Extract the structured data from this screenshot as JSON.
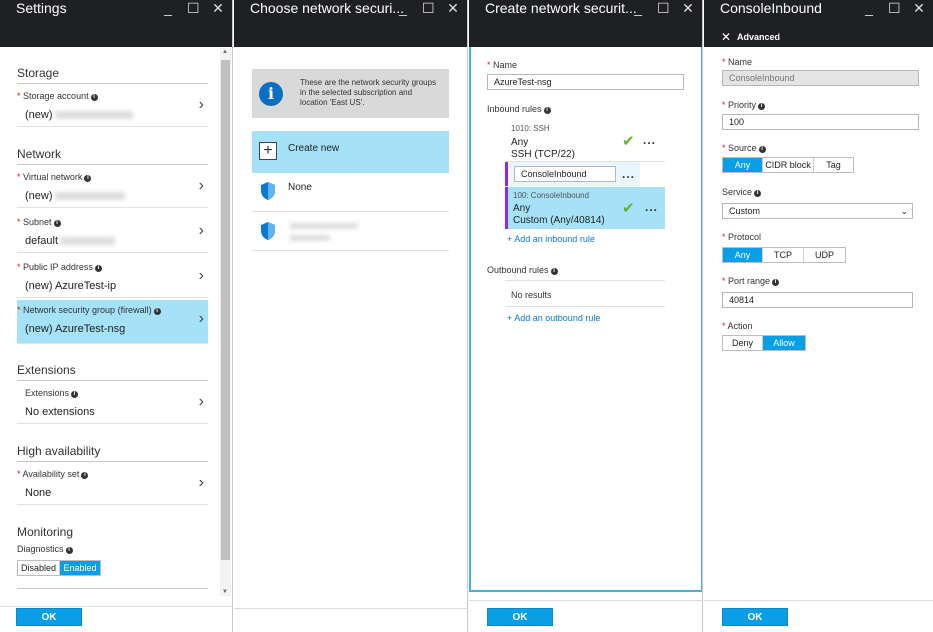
{
  "window_controls": {
    "minimize": "_",
    "maximize": "☐",
    "close": "✕"
  },
  "settings": {
    "title": "Settings",
    "storage": {
      "heading": "Storage",
      "account_label": "Storage account",
      "account_value": "(new)"
    },
    "network": {
      "heading": "Network",
      "vnet_label": "Virtual network",
      "vnet_value": "(new)",
      "subnet_label": "Subnet",
      "subnet_value": "default",
      "pip_label": "Public IP address",
      "pip_value": "(new) AzureTest-ip",
      "nsg_label": "Network security group (firewall)",
      "nsg_value": "(new) AzureTest-nsg"
    },
    "extensions": {
      "heading": "Extensions",
      "label": "Extensions",
      "value": "No extensions"
    },
    "ha": {
      "heading": "High availability",
      "label": "Availability set",
      "value": "None"
    },
    "monitoring": {
      "heading": "Monitoring",
      "label": "Diagnostics",
      "options": [
        "Disabled",
        "Enabled"
      ],
      "selected": "Enabled"
    },
    "ok": "OK"
  },
  "choose": {
    "title": "Choose network securi...",
    "info_text": "These are the network security groups in the selected subscription and location 'East US'.",
    "create_new": "Create new",
    "none": "None",
    "icons": {
      "info": "info-icon",
      "plus": "plus-icon",
      "shield": "shield-icon"
    }
  },
  "create": {
    "title": "Create network securit...",
    "name_label": "Name",
    "name_value": "AzureTest-nsg",
    "inbound_label": "Inbound rules",
    "rule1": {
      "header": "1010: SSH",
      "source": "Any",
      "service": "SSH (TCP/22)"
    },
    "edit_value": "ConsoleInbound",
    "rule2": {
      "header": "100: ConsoleInbound",
      "source": "Any",
      "service": "Custom (Any/40814)"
    },
    "add_inbound": "+ Add an inbound rule",
    "outbound_label": "Outbound rules",
    "no_results": "No results",
    "add_outbound": "+ Add an outbound rule",
    "more": "...",
    "ok": "OK"
  },
  "rule": {
    "title": "ConsoleInbound",
    "advanced": "Advanced",
    "name_label": "Name",
    "name_value": "ConsoleInbound",
    "priority_label": "Priority",
    "priority_value": "100",
    "source_label": "Source",
    "source_options": [
      "Any",
      "CIDR block",
      "Tag"
    ],
    "source_selected": "Any",
    "service_label": "Service",
    "service_value": "Custom",
    "protocol_label": "Protocol",
    "protocol_options": [
      "Any",
      "TCP",
      "UDP"
    ],
    "protocol_selected": "Any",
    "port_label": "Port range",
    "port_value": "40814",
    "action_label": "Action",
    "action_options": [
      "Deny",
      "Allow"
    ],
    "action_selected": "Allow",
    "ok": "OK"
  },
  "colors": {
    "accent": "#0a9ee6",
    "selected": "#a5e1f7",
    "header": "#1f2023",
    "check": "#5ab52b"
  }
}
